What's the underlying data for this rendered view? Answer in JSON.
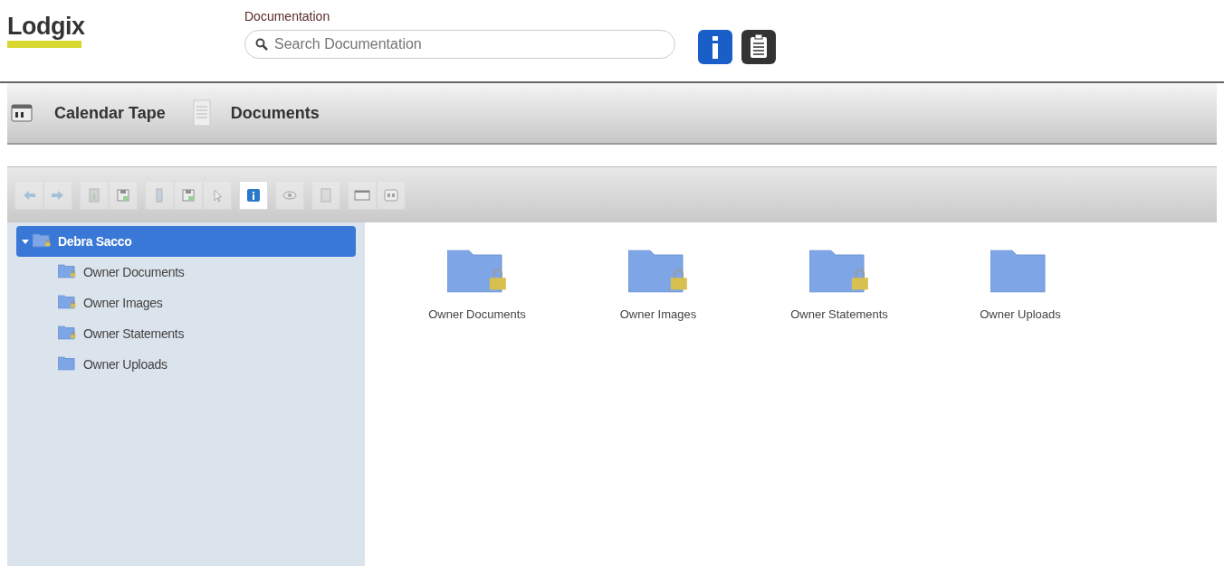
{
  "logo": {
    "text": "Lodgix"
  },
  "search": {
    "label": "Documentation",
    "placeholder": "Search Documentation"
  },
  "header_buttons": [
    {
      "kind": "info"
    },
    {
      "kind": "clipboard"
    }
  ],
  "nav": [
    {
      "label": "Calendar Tape",
      "kind": "calendar"
    },
    {
      "label": "Documents",
      "kind": "document"
    }
  ],
  "toolbar": [
    [
      {
        "kind": "back",
        "disabled": true
      },
      {
        "kind": "forward",
        "disabled": true
      }
    ],
    [
      {
        "kind": "download",
        "disabled": true
      },
      {
        "kind": "save",
        "disabled": true
      }
    ],
    [
      {
        "kind": "column",
        "disabled": true
      },
      {
        "kind": "save",
        "disabled": true
      },
      {
        "kind": "cursor",
        "disabled": true
      }
    ],
    [
      {
        "kind": "info",
        "disabled": false
      }
    ],
    [
      {
        "kind": "eye",
        "disabled": true
      }
    ],
    [
      {
        "kind": "document",
        "disabled": true
      }
    ],
    [
      {
        "kind": "window",
        "disabled": true
      },
      {
        "kind": "preview",
        "disabled": true
      }
    ]
  ],
  "tree": [
    {
      "label": "Debra Sacco",
      "expanded": true,
      "selected": true,
      "locked": true,
      "children": [
        {
          "label": "Owner Documents",
          "selected": false,
          "locked": true
        },
        {
          "label": "Owner Images",
          "selected": false,
          "locked": true
        },
        {
          "label": "Owner Statements",
          "selected": false,
          "locked": true
        },
        {
          "label": "Owner Uploads",
          "selected": false,
          "locked": false
        }
      ]
    }
  ],
  "folders": [
    {
      "label": "Owner Documents",
      "locked": true
    },
    {
      "label": "Owner Images",
      "locked": true
    },
    {
      "label": "Owner Statements",
      "locked": true
    },
    {
      "label": "Owner Uploads",
      "locked": false
    }
  ]
}
